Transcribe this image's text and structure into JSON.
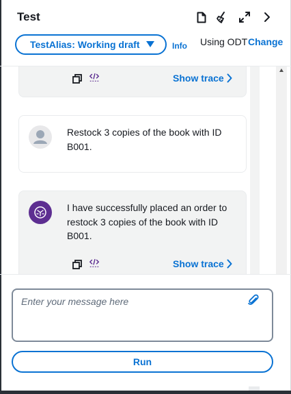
{
  "panel": {
    "title": "Test"
  },
  "header": {
    "alias_label": "TestAlias: Working draft",
    "info_label": "Info",
    "odt_label": "Using ODT",
    "change_label": "Change",
    "icons": [
      "document-icon",
      "broom-icon",
      "expand-icon",
      "chevron-right-icon"
    ]
  },
  "messages": [
    {
      "role": "agent",
      "text": "",
      "show_trace_label": "Show trace"
    },
    {
      "role": "user",
      "text": "Restock 3 copies of the book with ID B001."
    },
    {
      "role": "agent",
      "text": "I have successfully placed an order to restock 3 copies of the book with ID B001.",
      "show_trace_label": "Show trace"
    }
  ],
  "input": {
    "placeholder": "Enter your message here"
  },
  "run": {
    "label": "Run"
  },
  "colors": {
    "accent": "#0972d3",
    "agent_bubble": "#f2f3f3",
    "bot_avatar": "#5d2e91"
  }
}
